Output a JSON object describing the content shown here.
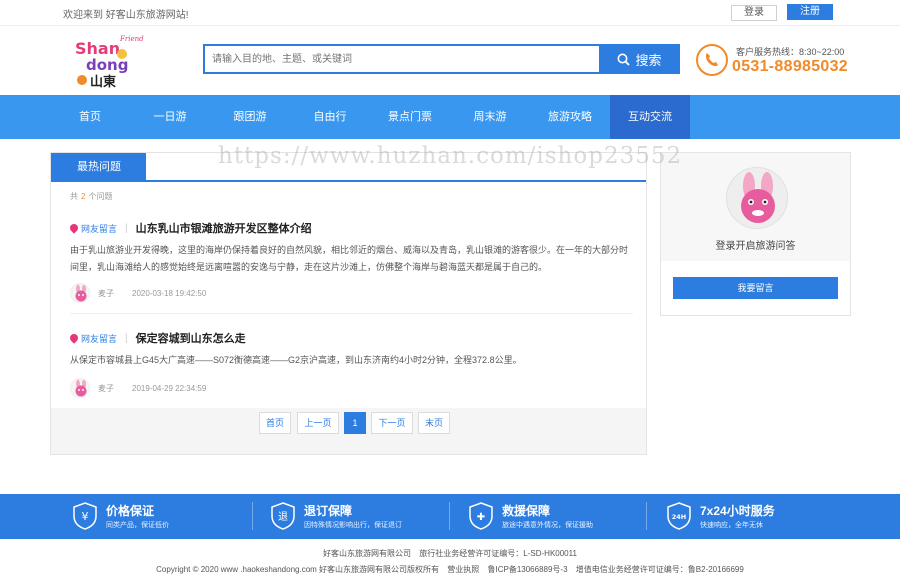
{
  "topbar": {
    "welcome": "欢迎来到 好客山东旅游网站!",
    "login": "登录",
    "register": "注册"
  },
  "logo": {
    "alt": "Friendly Shandong 山東",
    "friendly": "Friendly",
    "shan": "Shan",
    "dong": "dong",
    "cn": "山東"
  },
  "search": {
    "placeholder": "请输入目的地、主题、或关键词",
    "button": "搜索"
  },
  "hotline": {
    "label": "客户服务热线：8:30~22:00",
    "number": "0531-88985032"
  },
  "nav": {
    "items": [
      "首页",
      "一日游",
      "跟团游",
      "自由行",
      "景点门票",
      "周末游",
      "旅游攻略",
      "互动交流"
    ],
    "active_index": 7
  },
  "questions": {
    "tab": "最热问题",
    "count_prefix": "共",
    "count": "2",
    "count_suffix": "个问题",
    "items": [
      {
        "tag": "网友留言",
        "title": "山东乳山市银滩旅游开发区整体介绍",
        "body": "由于乳山旅游业开发得晚，这里的海岸仍保持着良好的自然风貌，相比邻近的烟台、威海以及青岛，乳山银滩的游客很少。在一年的大部分时间里，乳山海滩给人的感觉始终是远离喧嚣的安逸与宁静，走在这片沙滩上，仿佛整个海岸与碧海蓝天都是属于自己的。",
        "user": "麦子",
        "date": "2020-03-18 19:42:50"
      },
      {
        "tag": "网友留言",
        "title": "保定容城到山东怎么走",
        "body": "从保定市容城县上G45大广高速——S072衡德高速——G2京沪高速，到山东济南约4小时2分钟，全程372.8公里。",
        "user": "麦子",
        "date": "2019-04-29 22:34:59"
      }
    ]
  },
  "pagination": {
    "first": "首页",
    "prev": "上一页",
    "current": "1",
    "next": "下一页",
    "last": "末页"
  },
  "side": {
    "text": "登录开启旅游问答",
    "button": "我要留言"
  },
  "watermark": "https://www.huzhan.com/ishop23552",
  "services": [
    {
      "icon": "yuan-shield-icon",
      "glyph": "¥",
      "title": "价格保证",
      "sub": "同类产品，保证低价"
    },
    {
      "icon": "refund-shield-icon",
      "glyph": "退",
      "title": "退订保障",
      "sub": "因特殊情况影响出行，保证退订"
    },
    {
      "icon": "rescue-shield-icon",
      "glyph": "✚",
      "title": "救援保障",
      "sub": "旅途中遇意外情况，保证援助"
    },
    {
      "icon": "24h-shield-icon",
      "glyph": "24H",
      "title": "7x24小时服务",
      "sub": "快速响应，全年无休"
    }
  ],
  "footer": {
    "company": "好客山东旅游网有限公司",
    "license": "旅行社业务经营许可证编号：L-SD-HK00011",
    "copyright": "Copyright © 2020 www .haokeshandong.com 好客山东旅游网有限公司版权所有",
    "biz_license": "营业执照",
    "icp": "鲁ICP备13066889号-3",
    "telecom": "增值电信业务经营许可证编号：鲁B2-20166699"
  },
  "colors": {
    "primary": "#2d7de0",
    "nav": "#3a97f0",
    "nav_active": "#2b6bd0",
    "accent": "#f08a2a",
    "tag_pin": "#e6357b"
  }
}
